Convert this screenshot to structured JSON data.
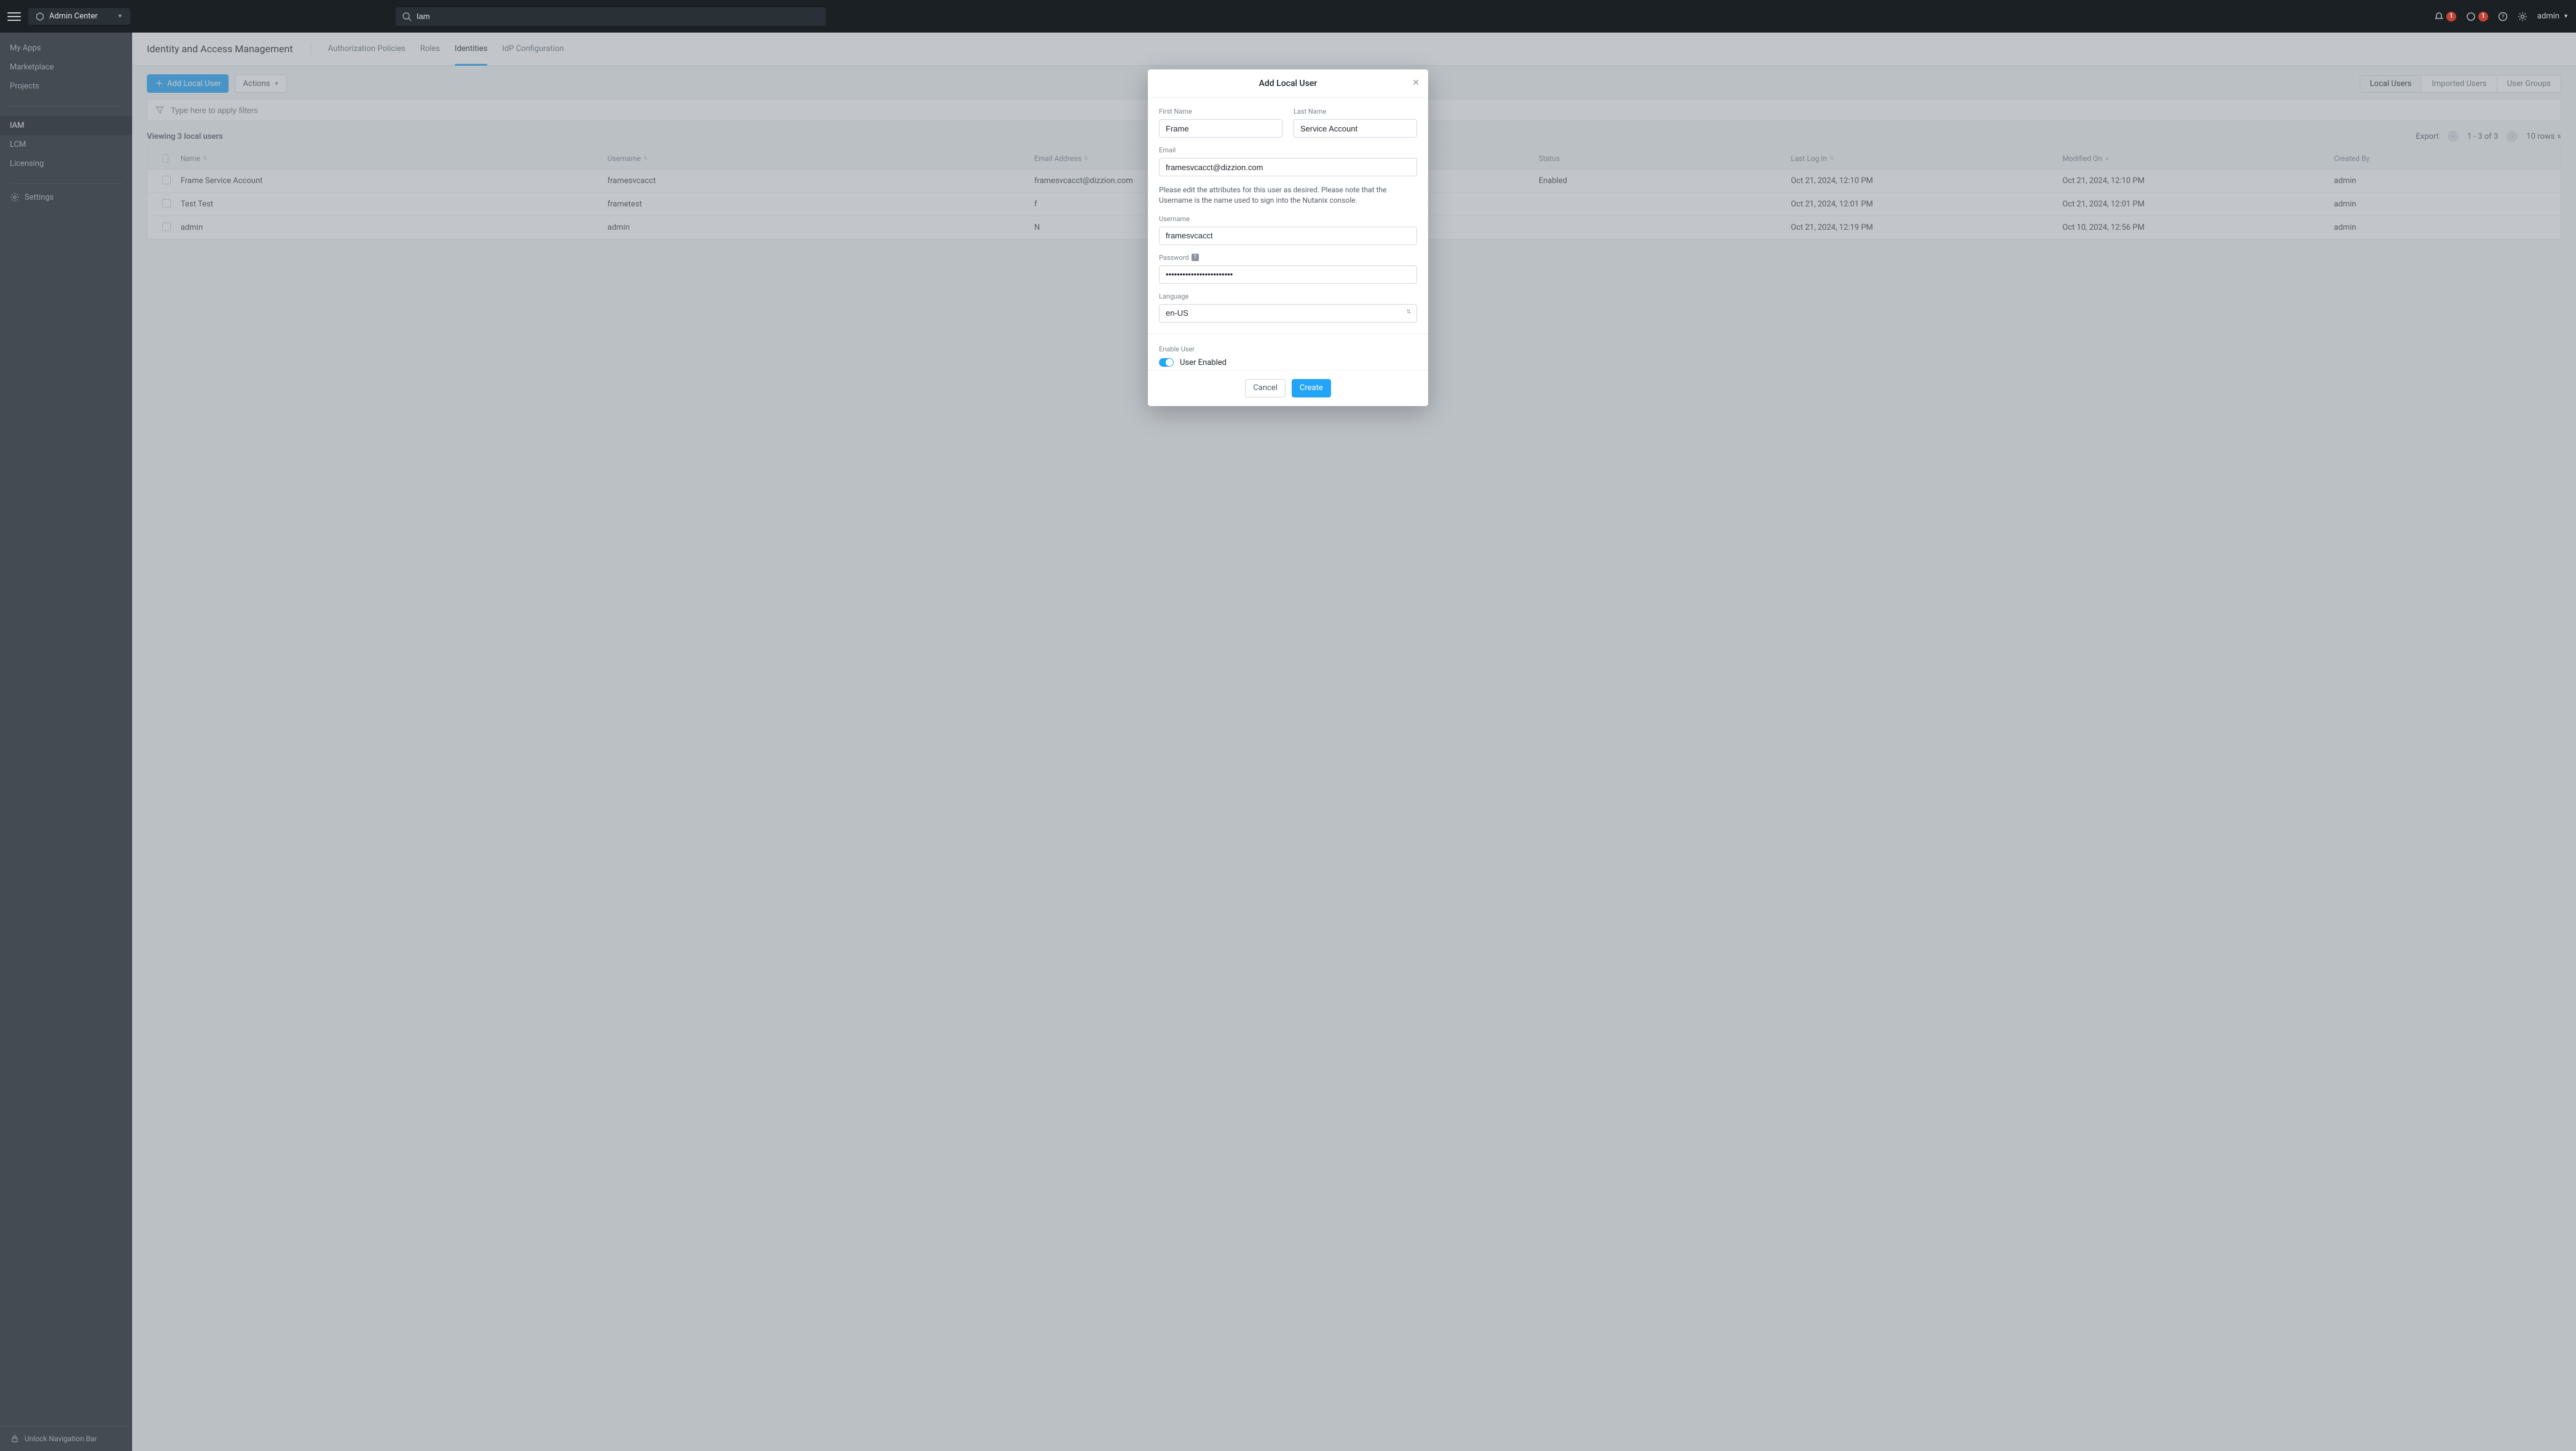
{
  "topbar": {
    "app_label": "Admin Center",
    "search_value": "Iam",
    "bell_count": "1",
    "warn_count": "1",
    "user_label": "admin"
  },
  "sidebar": {
    "items": [
      {
        "label": "My Apps"
      },
      {
        "label": "Marketplace"
      },
      {
        "label": "Projects"
      }
    ],
    "items2": [
      {
        "label": "IAM",
        "active": true
      },
      {
        "label": "LCM"
      },
      {
        "label": "Licensing"
      }
    ],
    "settings_label": "Settings",
    "footer_label": "Unlock Navigation Bar"
  },
  "page": {
    "title": "Identity and Access Management",
    "tabs": [
      {
        "label": "Authorization Policies"
      },
      {
        "label": "Roles"
      },
      {
        "label": "Identities",
        "active": true
      },
      {
        "label": "IdP Configuration"
      }
    ]
  },
  "toolbar": {
    "add_label": "Add Local User",
    "actions_label": "Actions",
    "seg": [
      {
        "label": "Local Users",
        "active": true
      },
      {
        "label": "Imported Users"
      },
      {
        "label": "User Groups"
      }
    ]
  },
  "filter": {
    "placeholder": "Type here to apply filters"
  },
  "listmeta": {
    "viewing": "Viewing 3 local users",
    "export": "Export",
    "range": "1 - 3 of 3",
    "rows_label": "10 rows"
  },
  "columns": [
    "Name",
    "Username",
    "Email Address",
    "Status",
    "Last Log In",
    "Modified On",
    "Created By"
  ],
  "rows": [
    {
      "name": "Frame Service Account",
      "username": "framesvcacct",
      "email": "framesvcacct@dizzion.com",
      "status": "Enabled",
      "lastlogin": "Oct 21, 2024, 12:10 PM",
      "modified": "Oct 21, 2024, 12:10 PM",
      "createdby": "admin"
    },
    {
      "name": "Test Test",
      "username": "frametest",
      "email": "f",
      "status": "",
      "lastlogin": "Oct 21, 2024, 12:01 PM",
      "modified": "Oct 21, 2024, 12:01 PM",
      "createdby": "admin"
    },
    {
      "name": "admin",
      "username": "admin",
      "email": "N",
      "status": "",
      "lastlogin": "Oct 21, 2024, 12:19 PM",
      "modified": "Oct 10, 2024, 12:56 PM",
      "createdby": "admin"
    }
  ],
  "modal": {
    "title": "Add Local User",
    "first_name_label": "First Name",
    "first_name_value": "Frame",
    "last_name_label": "Last Name",
    "last_name_value": "Service Account",
    "email_label": "Email",
    "email_value": "framesvcacct@dizzion.com",
    "helper": "Please edit the attributes for this user as desired. Please note that the Username is the name used to sign into the Nutanix console.",
    "username_label": "Username",
    "username_value": "framesvcacct",
    "password_label": "Password",
    "password_value": "••••••••••••••••••••••••",
    "language_label": "Language",
    "language_value": "en-US",
    "enable_section": "Enable User",
    "enable_text": "User Enabled",
    "cancel": "Cancel",
    "create": "Create"
  }
}
